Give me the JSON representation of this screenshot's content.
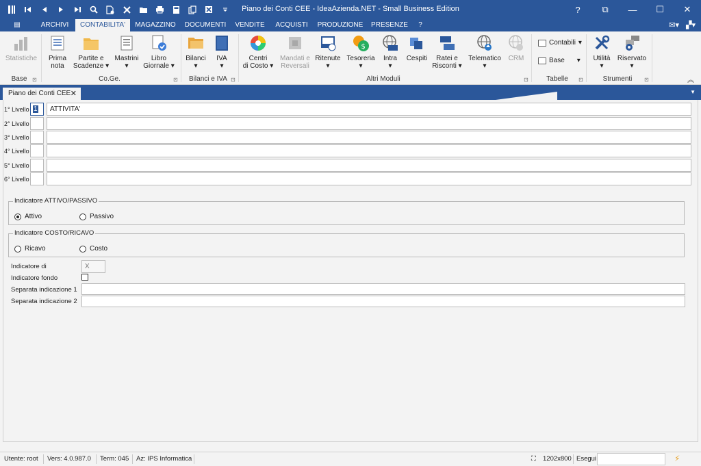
{
  "window": {
    "title": "Piano dei Conti CEE - IdeaAzienda.NET - Small Business Edition",
    "help": "?",
    "restore": "⧉",
    "minimize": "—",
    "maximize": "☐",
    "close": "✕"
  },
  "qat_icons": [
    "app-icon",
    "first-record-icon",
    "prev-record-icon",
    "next-record-icon",
    "last-record-icon",
    "search-icon",
    "new-document-icon",
    "delete-icon",
    "open-folder-icon",
    "print-icon",
    "calculator-icon",
    "copy-icon",
    "excel-icon",
    "customize-qat-icon"
  ],
  "tabs": {
    "file": "▤",
    "archivi": "ARCHIVI",
    "contabilita": "CONTABILITA'",
    "magazzino": "MAGAZZINO",
    "documenti": "DOCUMENTI",
    "vendite": "VENDITE",
    "acquisti": "ACQUISTI",
    "produzione": "PRODUZIONE",
    "presenze": "PRESENZE",
    "help": "?"
  },
  "ribbon": {
    "statistiche": "Statistiche",
    "prima_nota_1": "Prima",
    "prima_nota_2": "nota",
    "partite_1": "Partite e",
    "partite_2": "Scadenze",
    "mastrini": "Mastrini",
    "libro_1": "Libro",
    "libro_2": "Giornale",
    "bilanci": "Bilanci",
    "iva": "IVA",
    "centri_1": "Centri",
    "centri_2": "di Costo",
    "mandati_1": "Mandati e",
    "mandati_2": "Reversali",
    "ritenute": "Ritenute",
    "tesoreria": "Tesoreria",
    "intra": "Intra",
    "cespiti": "Cespiti",
    "ratei_1": "Ratei e",
    "ratei_2": "Risconti",
    "telematico": "Telematico",
    "crm": "CRM",
    "contabili": "Contabili",
    "base": "Base",
    "utilita": "Utilità",
    "riservato": "Riservato",
    "dropdown_arrow": "▾",
    "groups": {
      "base": "Base",
      "coge": "Co.Ge.",
      "bilanci_iva": "Bilanci e IVA",
      "altri_moduli": "Altri Moduli",
      "tabelle": "Tabelle",
      "strumenti": "Strumenti"
    },
    "launcher": "⊡",
    "collapse": "︽"
  },
  "doc_tab": {
    "label": "Piano dei Conti CEE",
    "close": "✕",
    "overflow": "▼"
  },
  "levels": [
    {
      "label": "1° Livello",
      "code": "1",
      "desc": "ATTIVITA'"
    },
    {
      "label": "2° Livello",
      "code": "",
      "desc": ""
    },
    {
      "label": "3° Livello",
      "code": "",
      "desc": ""
    },
    {
      "label": "4° Livello",
      "code": "",
      "desc": ""
    },
    {
      "label": "5° Livello",
      "code": "",
      "desc": ""
    },
    {
      "label": "6° Livello",
      "code": "",
      "desc": ""
    }
  ],
  "indicatore_ap": {
    "title": "Indicatore ATTIVO/PASSIVO",
    "attivo": "Attivo",
    "passivo": "Passivo",
    "selected": "attivo"
  },
  "indicatore_cr": {
    "title": "Indicatore COSTO/RICAVO",
    "ricavo": "Ricavo",
    "costo": "Costo",
    "selected": ""
  },
  "fields": {
    "indicatore_di": "Indicatore di",
    "indicatore_di_value": "X",
    "indicatore_fondo": "Indicatore fondo",
    "indicatore_fondo_checked": false,
    "separata_1": "Separata indicazione 1",
    "separata_1_value": "",
    "separata_2": "Separata indicazione 2",
    "separata_2_value": ""
  },
  "status": {
    "utente": "Utente: root",
    "vers": "Vers: 4.0.987.0",
    "term": "Term: 045",
    "az": "Az: IPS Informatica",
    "resolution": "1202x800",
    "esegui": "Esegui",
    "esegui_value": ""
  }
}
